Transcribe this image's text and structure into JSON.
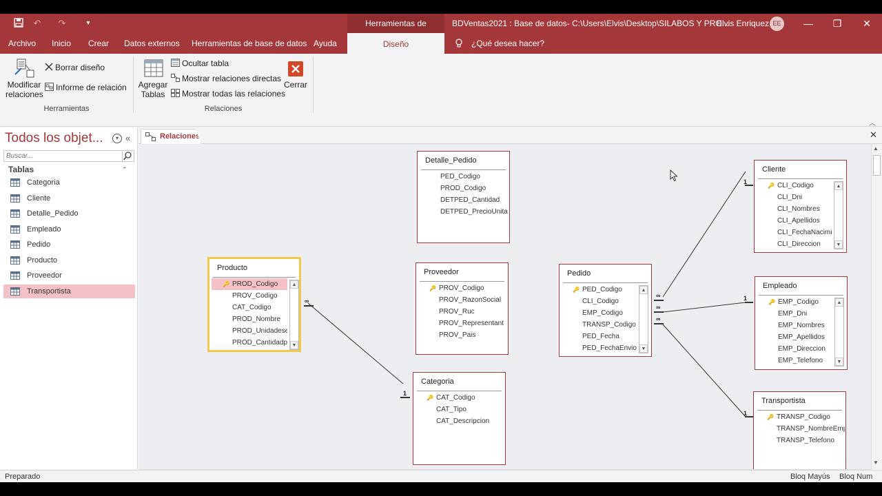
{
  "titlebar": {
    "context_tab": "Herramientas de relaciones",
    "document_title": "BDVentas2021 : Base de datos- C:\\Users\\Elvis\\Desktop\\SILABOS Y PRO...",
    "user_name": "Elvis Enriquez",
    "avatar_initials": "EE"
  },
  "ribbon_tabs": [
    "Archivo",
    "Inicio",
    "Crear",
    "Datos externos",
    "Herramientas de base de datos",
    "Ayuda"
  ],
  "active_tab": "Diseño",
  "tell_me": "¿Qué desea hacer?",
  "ribbon": {
    "modify_relations": "Modificar relaciones",
    "clear_layout": "Borrar diseño",
    "relation_report": "Informe de relación",
    "group_tools": "Herramientas",
    "add_tables": "Agregar Tablas",
    "hide_table": "Ocultar tabla",
    "show_direct": "Mostrar relaciones directas",
    "show_all": "Mostrar todas las relaciones",
    "close": "Cerrar",
    "group_relations": "Relaciones"
  },
  "nav": {
    "title": "Todos los objet...",
    "search_placeholder": "Buscar...",
    "section": "Tablas",
    "items": [
      "Categoria",
      "Cliente",
      "Detalle_Pedido",
      "Empleado",
      "Pedido",
      "Producto",
      "Proveedor",
      "Transportista"
    ],
    "selected": "Transportista"
  },
  "doc_tab": "Relaciones",
  "tables": {
    "detalle_pedido": {
      "title": "Detalle_Pedido",
      "fields": [
        "PED_Codigo",
        "PROD_Codigo",
        "DETPED_Cantidad",
        "DETPED_PrecioUnita"
      ]
    },
    "producto": {
      "title": "Producto",
      "fields": [
        "PROD_Codigo",
        "PROV_Codigo",
        "CAT_Codigo",
        "PROD_Nombre",
        "PROD_Unidadesen",
        "PROD_Cantidadp"
      ]
    },
    "proveedor": {
      "title": "Proveedor",
      "fields": [
        "PROV_Codigo",
        "PROV_RazonSocial",
        "PROV_Ruc",
        "PROV_Representant",
        "PROV_Pais"
      ]
    },
    "categoria": {
      "title": "Categoria",
      "fields": [
        "CAT_Codigo",
        "CAT_Tipo",
        "CAT_Descripcion"
      ]
    },
    "pedido": {
      "title": "Pedido",
      "fields": [
        "PED_Codigo",
        "CLI_Codigo",
        "EMP_Codigo",
        "TRANSP_Codigo",
        "PED_Fecha",
        "PED_FechaEnvio"
      ]
    },
    "cliente": {
      "title": "Cliente",
      "fields": [
        "CLI_Codigo",
        "CLI_Dni",
        "CLI_Nombres",
        "CLI_Apellidos",
        "CLI_FechaNacimie",
        "CLI_Direccion"
      ]
    },
    "empleado": {
      "title": "Empleado",
      "fields": [
        "EMP_Codigo",
        "EMP_Dni",
        "EMP_Nombres",
        "EMP_Apellidos",
        "EMP_Direccion",
        "EMP_Telefono"
      ]
    },
    "transportista": {
      "title": "Transportista",
      "fields": [
        "TRANSP_Codigo",
        "TRANSP_NombreEmp",
        "TRANSP_Telefono"
      ]
    }
  },
  "cardinality": {
    "one": "1",
    "many": "∞"
  },
  "status": {
    "left": "Preparado",
    "caps": "Bloq Mayús",
    "num": "Bloq Num"
  },
  "colors": {
    "accent": "#a4373a",
    "selection": "#f4c2c6",
    "active_border": "#f2c94c"
  }
}
